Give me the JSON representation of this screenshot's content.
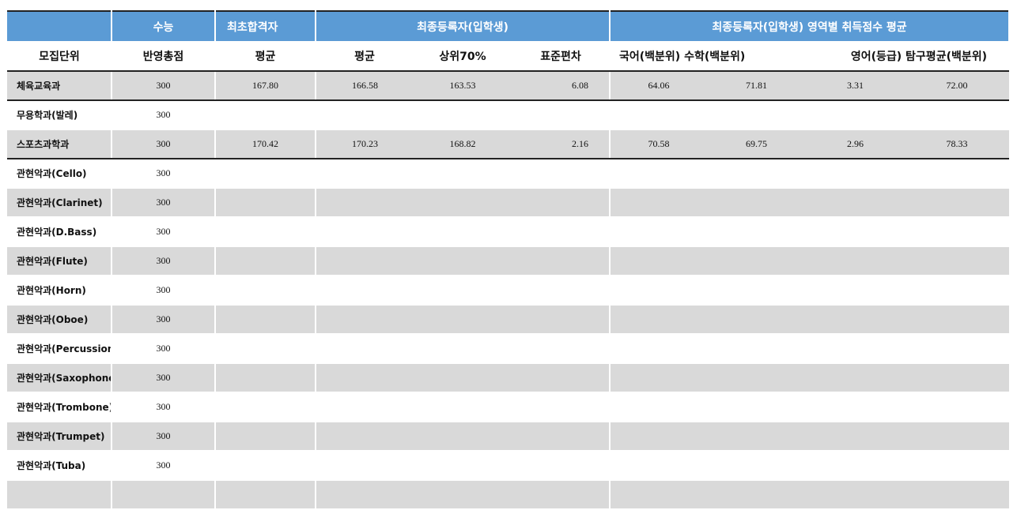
{
  "header_top": {
    "blank": "",
    "suneung": "수능",
    "first_pass": "최초합격자",
    "final_reg": "최종등록자(입학생)",
    "final_area": "최종등록자(입학생) 영역별 취득점수 평균"
  },
  "header_sub": {
    "unit": "모집단위",
    "total": "반영총점",
    "first_avg": "평균",
    "final_avg": "평균",
    "top70": "상위70%",
    "std": "표준편차",
    "kor_math": "국어(백분위) 수학(백분위)",
    "eng_explore": "영어(등급) 탐구평균(백분위)"
  },
  "rows": [
    {
      "name": "체육교육과",
      "total": "300",
      "first_avg": "167.80",
      "final_avg": "166.58",
      "top70": "163.53",
      "std": "6.08",
      "kor": "64.06",
      "math": "71.81",
      "eng": "3.31",
      "explore": "72.00"
    },
    {
      "name": "무용학과(발레)",
      "total": "300",
      "first_avg": "",
      "final_avg": "",
      "top70": "",
      "std": "",
      "kor": "",
      "math": "",
      "eng": "",
      "explore": ""
    },
    {
      "name": "스포츠과학과",
      "total": "300",
      "first_avg": "170.42",
      "final_avg": "170.23",
      "top70": "168.82",
      "std": "2.16",
      "kor": "70.58",
      "math": "69.75",
      "eng": "2.96",
      "explore": "78.33"
    },
    {
      "name": "관현악과(Cello)",
      "total": "300",
      "first_avg": "",
      "final_avg": "",
      "top70": "",
      "std": "",
      "kor": "",
      "math": "",
      "eng": "",
      "explore": ""
    },
    {
      "name": "관현악과(Clarinet)",
      "total": "300",
      "first_avg": "",
      "final_avg": "",
      "top70": "",
      "std": "",
      "kor": "",
      "math": "",
      "eng": "",
      "explore": ""
    },
    {
      "name": "관현악과(D.Bass)",
      "total": "300",
      "first_avg": "",
      "final_avg": "",
      "top70": "",
      "std": "",
      "kor": "",
      "math": "",
      "eng": "",
      "explore": ""
    },
    {
      "name": "관현악과(Flute)",
      "total": "300",
      "first_avg": "",
      "final_avg": "",
      "top70": "",
      "std": "",
      "kor": "",
      "math": "",
      "eng": "",
      "explore": ""
    },
    {
      "name": "관현악과(Horn)",
      "total": "300",
      "first_avg": "",
      "final_avg": "",
      "top70": "",
      "std": "",
      "kor": "",
      "math": "",
      "eng": "",
      "explore": ""
    },
    {
      "name": "관현악과(Oboe)",
      "total": "300",
      "first_avg": "",
      "final_avg": "",
      "top70": "",
      "std": "",
      "kor": "",
      "math": "",
      "eng": "",
      "explore": ""
    },
    {
      "name": "관현악과(Percussion)",
      "total": "300",
      "first_avg": "",
      "final_avg": "",
      "top70": "",
      "std": "",
      "kor": "",
      "math": "",
      "eng": "",
      "explore": ""
    },
    {
      "name": "관현악과(Saxophone)",
      "total": "300",
      "first_avg": "",
      "final_avg": "",
      "top70": "",
      "std": "",
      "kor": "",
      "math": "",
      "eng": "",
      "explore": ""
    },
    {
      "name": "관현악과(Trombone)",
      "total": "300",
      "first_avg": "",
      "final_avg": "",
      "top70": "",
      "std": "",
      "kor": "",
      "math": "",
      "eng": "",
      "explore": ""
    },
    {
      "name": "관현악과(Trumpet)",
      "total": "300",
      "first_avg": "",
      "final_avg": "",
      "top70": "",
      "std": "",
      "kor": "",
      "math": "",
      "eng": "",
      "explore": ""
    },
    {
      "name": "관현악과(Tuba)",
      "total": "300",
      "first_avg": "",
      "final_avg": "",
      "top70": "",
      "std": "",
      "kor": "",
      "math": "",
      "eng": "",
      "explore": ""
    },
    {
      "name": "",
      "total": "",
      "first_avg": "",
      "final_avg": "",
      "top70": "",
      "std": "",
      "kor": "",
      "math": "",
      "eng": "",
      "explore": ""
    }
  ],
  "colors": {
    "header_bg": "#5b9bd5",
    "shade": "#d9d9d9",
    "rule": "#222222"
  }
}
